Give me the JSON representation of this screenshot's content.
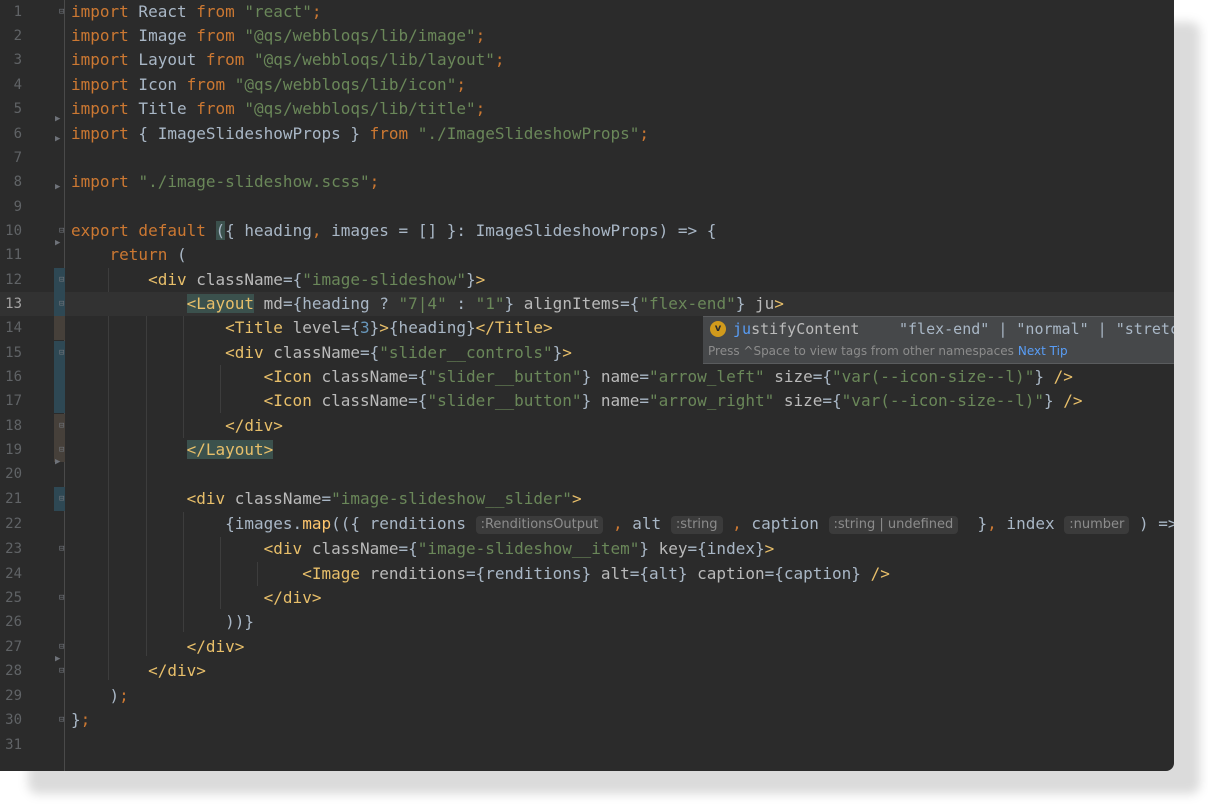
{
  "editor": {
    "line_numbers": [
      "1",
      "2",
      "3",
      "4",
      "5",
      "6",
      "7",
      "8",
      "9",
      "10",
      "11",
      "12",
      "13",
      "14",
      "15",
      "16",
      "17",
      "18",
      "19",
      "20",
      "21",
      "22",
      "23",
      "24",
      "25",
      "26",
      "27",
      "28",
      "29",
      "30",
      "31"
    ],
    "current_line": "13"
  },
  "completion": {
    "icon_letter": "v",
    "match_prefix": "ju",
    "name_rest": "stifyContent",
    "values": "\"flex-end\" | \"normal\" | \"stretch\"",
    "footer_hint": "Press ^Space to view tags from other namespaces",
    "next_tip_label": "Next Tip"
  },
  "colors": {
    "background": "#2b2b2b",
    "keyword": "#cc7832",
    "string": "#6a8759",
    "number": "#6897bb",
    "tag": "#e8bf6a",
    "popup": "#46484a",
    "link": "#589df6"
  }
}
